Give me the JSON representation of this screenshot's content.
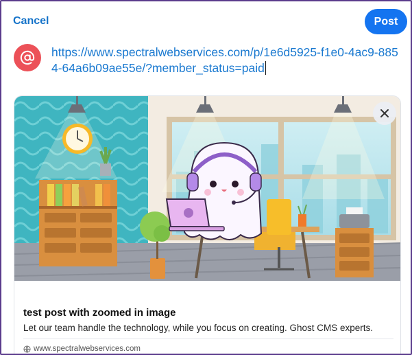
{
  "header": {
    "cancel_label": "Cancel",
    "post_label": "Post"
  },
  "composer": {
    "avatar_icon": "at-sign-icon",
    "url_text": "https://www.spectralwebservices.com/p/1e6d5925-f1e0-4ac9-8854-64a6b09ae55e/?member_status=paid"
  },
  "link_card": {
    "title": "test post with zoomed in image",
    "description": "Let our team handle the technology, while you focus on creating.  Ghost CMS experts.",
    "domain": "www.spectralwebservices.com",
    "close_icon": "close-icon"
  },
  "colors": {
    "accent": "#1474f0",
    "link": "#1a79d0",
    "avatar": "#ec5158",
    "frame": "#5b3c8c"
  }
}
